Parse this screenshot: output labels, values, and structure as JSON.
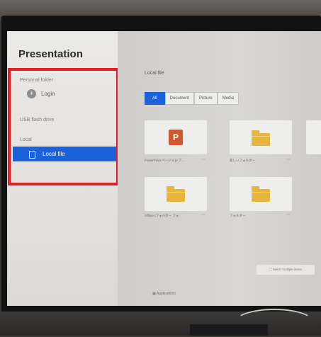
{
  "app": {
    "title": "Presentation"
  },
  "sidebar": {
    "personal_label": "Personal folder",
    "login_label": "Login",
    "usb_label": "USB flash drive",
    "local_label": "Local",
    "local_file_label": "Local file"
  },
  "main": {
    "breadcrumb": "Local file",
    "filters": [
      "All",
      "Document",
      "Picture",
      "Media"
    ],
    "active_filter": "All",
    "files": [
      {
        "name": "PowerPoint ページ 2 (2 ア...",
        "type": "ppt",
        "icon": "powerpoint-icon"
      },
      {
        "name": "新しいフォルダー",
        "type": "folder",
        "icon": "folder-icon"
      },
      {
        "name": "Offline (フォルダー フォ",
        "type": "folder",
        "icon": "folder-icon"
      },
      {
        "name": "フォルダー",
        "type": "folder",
        "icon": "folder-icon"
      }
    ],
    "select_multiple_label": "Select multiple items",
    "apps_label": "Applications"
  },
  "colors": {
    "accent": "#1b62d8",
    "highlight": "#e21f26",
    "folder": "#e7b43e",
    "ppt": "#d3572b"
  }
}
